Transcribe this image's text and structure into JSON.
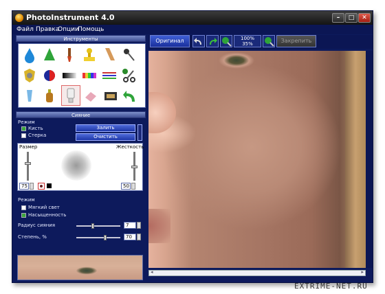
{
  "window": {
    "title": "PhotoInstrument 4.0"
  },
  "menu": {
    "items": [
      "Файл",
      "Правка",
      "Опции",
      "Помощь"
    ]
  },
  "tools_panel": {
    "title": "Инструменты",
    "tools": [
      "water-drop-icon",
      "cone-icon",
      "brush-icon",
      "stamp-icon",
      "pencil-icon",
      "pin-icon",
      "shield-icon",
      "color-circle-icon",
      "gradient-bar-icon",
      "color-bars-icon",
      "lines-icon",
      "scissors-icon",
      "tube-icon",
      "bottle-icon",
      "glow-tool-icon",
      "eraser-icon",
      "film-icon",
      "undo-arrow-icon"
    ],
    "selected_tool": "glow-tool-icon"
  },
  "glow_panel": {
    "title": "Сияние",
    "mode_label": "Режим",
    "brush_label": "Кисть",
    "brush_checked": true,
    "eraser_label": "Стерка",
    "eraser_checked": false,
    "fill_button": "Залить",
    "clear_button": "Очистить",
    "size_label": "Размер",
    "hardness_label": "Жесткость",
    "size_value": "75",
    "hardness_value": "50",
    "mode2_label": "Режим",
    "soft_light_label": "Мягкий свет",
    "soft_light_checked": false,
    "saturation_label": "Насыщенность",
    "saturation_checked": true,
    "radius_label": "Радиус сияния",
    "radius_value": "7",
    "radius_fraction": 0.38,
    "degree_label": "Степень, %",
    "degree_value": "70",
    "degree_fraction": 0.66
  },
  "toolbar": {
    "original_button": "Оригинал",
    "zoom_top": "100%",
    "zoom_bottom": "35%",
    "pin_button": "Закрепить"
  },
  "watermark": "EXTRIME-NET.RU",
  "colors": {
    "window_bg": "#0d1a5c",
    "accent": "#1d36a8",
    "checked": "#3ca53c"
  }
}
